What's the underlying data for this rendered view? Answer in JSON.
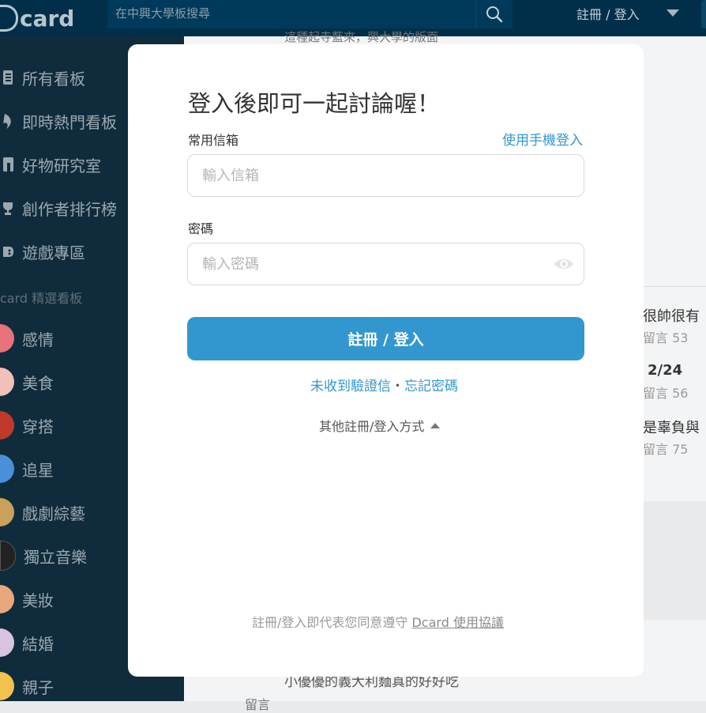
{
  "topbar": {
    "logo_text": "card",
    "search_placeholder": "在中興大學板搜尋",
    "auth_label": "註冊 / 登入"
  },
  "sidebar": {
    "main_items": [
      {
        "label": "所有看板",
        "icon": "list-icon"
      },
      {
        "label": "即時熱門看板",
        "icon": "flame-icon"
      },
      {
        "label": "好物研究室",
        "icon": "store-icon"
      },
      {
        "label": "創作者排行榜",
        "icon": "trophy-icon"
      },
      {
        "label": "遊戲專區",
        "icon": "gamepad-icon"
      }
    ],
    "section_title": "card 精選看板",
    "boards": [
      {
        "label": "感情",
        "color": "#e8727a"
      },
      {
        "label": "美食",
        "color": "#f1c0b8"
      },
      {
        "label": "穿搭",
        "color": "#c0392b"
      },
      {
        "label": "追星",
        "color": "#4a90d9"
      },
      {
        "label": "戲劇綜藝",
        "color": "#c9a15a"
      },
      {
        "label": "獨立音樂",
        "color": "#222222"
      },
      {
        "label": "美妝",
        "color": "#e9a77e"
      },
      {
        "label": "結婚",
        "color": "#d8c4e0"
      },
      {
        "label": "親子",
        "color": "#f2c14e"
      }
    ]
  },
  "background": {
    "top_snippet": "這種起寺藍來，興大學的版面",
    "posts": [
      {
        "title": "很帥很有",
        "meta": "留言 53"
      },
      {
        "title": "2/24",
        "meta": "留言 56"
      },
      {
        "title": "是辜負與",
        "meta": "留言 75"
      }
    ],
    "bottom_snippet": "小優優的義大利麵真的好好吃",
    "bottom_label": "留言"
  },
  "modal": {
    "title": "登入後即可一起討論喔！",
    "email_label": "常用信箱",
    "phone_login": "使用手機登入",
    "email_placeholder": "輸入信箱",
    "password_label": "密碼",
    "password_placeholder": "輸入密碼",
    "submit_label": "註冊 / 登入",
    "no_verify": "未收到驗證信",
    "separator": "・",
    "forgot": "忘記密碼",
    "other_methods": "其他註冊/登入方式",
    "terms_prefix": "註冊/登入即代表您同意遵守 ",
    "terms_link": "Dcard 使用協議"
  },
  "colors": {
    "topbar": "#012f4a",
    "sidebar": "#102c3c",
    "accent": "#3397cf"
  }
}
